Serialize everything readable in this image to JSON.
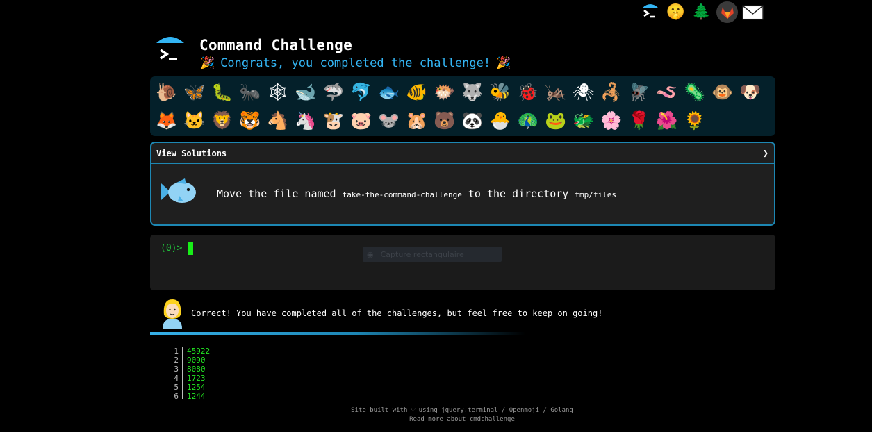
{
  "top_icons": [
    {
      "name": "terminal-logo-icon",
      "glyph": ">_"
    },
    {
      "name": "shushing-face-icon",
      "glyph": "🤫"
    },
    {
      "name": "evergreen-tree-icon",
      "glyph": "🌲"
    },
    {
      "name": "gitlab-icon",
      "glyph": "🦊"
    },
    {
      "name": "envelope-icon",
      "glyph": "✉"
    }
  ],
  "header": {
    "title": "Command Challenge",
    "congrats_text": "Congrats, you completed the challenge!",
    "party_glyph": "🎉"
  },
  "emoji_grid": [
    {
      "name": "snail-icon",
      "glyph": "🐌"
    },
    {
      "name": "butterfly-icon",
      "glyph": "🦋"
    },
    {
      "name": "bug-icon",
      "glyph": "🐛"
    },
    {
      "name": "ant-icon",
      "glyph": "🐜"
    },
    {
      "name": "spider-web-icon",
      "glyph": "🕸"
    },
    {
      "name": "whale-icon",
      "glyph": "🐋"
    },
    {
      "name": "shark-icon",
      "glyph": "🦈"
    },
    {
      "name": "dolphin-icon",
      "glyph": "🐬"
    },
    {
      "name": "fish-icon",
      "glyph": "🐟"
    },
    {
      "name": "tropical-fish-icon",
      "glyph": "🐠"
    },
    {
      "name": "blowfish-icon",
      "glyph": "🐡"
    },
    {
      "name": "wolf-icon",
      "glyph": "🐺"
    },
    {
      "name": "bee-icon",
      "glyph": "🐝"
    },
    {
      "name": "lady-beetle-icon",
      "glyph": "🐞"
    },
    {
      "name": "cricket-icon",
      "glyph": "🦗"
    },
    {
      "name": "spider-icon",
      "glyph": "🕷"
    },
    {
      "name": "scorpion-icon",
      "glyph": "🦂"
    },
    {
      "name": "fly-icon",
      "glyph": "🪰"
    },
    {
      "name": "worm-icon",
      "glyph": "🪱"
    },
    {
      "name": "microbe-icon",
      "glyph": "🦠"
    },
    {
      "name": "monkey-icon",
      "glyph": "🐵"
    },
    {
      "name": "dog-icon",
      "glyph": "🐶"
    },
    {
      "name": "fox-icon",
      "glyph": "🦊"
    },
    {
      "name": "cat-icon",
      "glyph": "🐱"
    },
    {
      "name": "lion-icon",
      "glyph": "🦁"
    },
    {
      "name": "tiger-icon",
      "glyph": "🐯"
    },
    {
      "name": "horse-icon",
      "glyph": "🐴"
    },
    {
      "name": "unicorn-icon",
      "glyph": "🦄"
    },
    {
      "name": "cow-icon",
      "glyph": "🐮"
    },
    {
      "name": "pig-icon",
      "glyph": "🐷"
    },
    {
      "name": "mouse-icon",
      "glyph": "🐭"
    },
    {
      "name": "hamster-icon",
      "glyph": "🐹"
    },
    {
      "name": "bear-icon",
      "glyph": "🐻"
    },
    {
      "name": "panda-icon",
      "glyph": "🐼"
    },
    {
      "name": "hatching-chick-icon",
      "glyph": "🐣"
    },
    {
      "name": "peacock-icon",
      "glyph": "🦚"
    },
    {
      "name": "frog-icon",
      "glyph": "🐸"
    },
    {
      "name": "dragon-icon",
      "glyph": "🐲"
    },
    {
      "name": "cherry-blossom-icon",
      "glyph": "🌸"
    },
    {
      "name": "rose-icon",
      "glyph": "🌹"
    },
    {
      "name": "hibiscus-icon",
      "glyph": "🌺"
    },
    {
      "name": "sunflower-icon",
      "glyph": "🌻"
    }
  ],
  "panel": {
    "header_label": "View Solutions",
    "chevron_glyph": "❯",
    "task_prefix": "Move the file named",
    "task_file": "take-the-command-challenge",
    "task_middle": "to the directory",
    "task_dir": "tmp/files"
  },
  "terminal": {
    "prompt": "(0)>",
    "overlay_text": "Capture rectangulaire",
    "overlay_glyph": "◉"
  },
  "result": {
    "message": "Correct! You have completed all of the challenges, but feel free to keep on going!"
  },
  "output": {
    "line_numbers": [
      "1",
      "2",
      "3",
      "4",
      "5",
      "6"
    ],
    "values": [
      "45922",
      "9090",
      "8080",
      "1723",
      "1254",
      "1244"
    ]
  },
  "footer": {
    "line1": "Site built with ♡ using jquery.terminal / Openmoji / Golang",
    "line2": "Read more about cmdchallenge"
  },
  "colors": {
    "accent": "#33b5f4",
    "border": "#1d87b3",
    "terminal_green": "#22c93d",
    "grid_bg": "#04202a"
  }
}
